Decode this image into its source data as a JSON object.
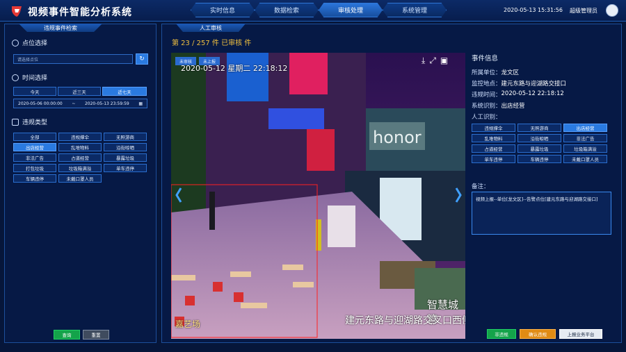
{
  "header": {
    "title": "视频事件智能分析系统",
    "nav": [
      "实时信息",
      "数据检索",
      "审核处理",
      "系统管理"
    ],
    "active_nav": 2,
    "datetime": "2020-05-13 15:31:56",
    "user": "超级管理员"
  },
  "left": {
    "panel_title": "违规事件检索",
    "location_title": "点位选择",
    "location_placeholder": "请选择点位",
    "time_title": "时间选择",
    "time_tabs": [
      "今天",
      "近三天",
      "近七天"
    ],
    "time_active": 2,
    "date_start": "2020-05-06 00:00:00",
    "date_sep": "~",
    "date_end": "2020-05-13 23:59:59",
    "violation_title": "违规类型",
    "violation_types": [
      "全部",
      "违规撑伞",
      "无照游商",
      "出店经营",
      "乱堆物料",
      "沿街晾晒",
      "非法广告",
      "占道经营",
      "暴露垃圾",
      "打包垃圾",
      "垃圾箱满溢",
      "单车违停",
      "车辆违停",
      "未戴口罩人员"
    ],
    "violation_active": 3,
    "query_label": "查询",
    "reset_label": "重置"
  },
  "middle": {
    "panel_title": "人工审核",
    "progress_text": "第 23 / 257 件 已审核 件",
    "tag_unreviewed": "未审核",
    "tag_unreported": "未上报",
    "overlay_date": "2020-05-12 星期二 22:18:12",
    "overlay_brand": "智慧城管",
    "overlay_location": "建元东路与迎湖路交叉口西侧",
    "overlay_corner": "嘉艺场"
  },
  "right": {
    "panel_title": "事件信息",
    "unit_label": "所属单位：",
    "unit_value": "龙文区",
    "site_label": "监控地点：",
    "site_value": "建元东路与迎湖路交接口",
    "time_label": "违规时间：",
    "time_value": "2020-05-12 22:18:12",
    "sys_label": "系统识别：",
    "sys_value": "出店经营",
    "manual_label": "人工识别：",
    "manual_types": [
      "违规撑伞",
      "无照游商",
      "出店经营",
      "乱堆物料",
      "沿街晾晒",
      "非法广告",
      "占道经营",
      "暴露垃圾",
      "垃圾箱满溢",
      "单车违停",
      "车辆违停",
      "未戴口罩人员"
    ],
    "manual_active": 2,
    "note_label": "备注：",
    "note_text": "视频上报--单位[龙文区]--告警点位[建元东路与迎湖路交接口]",
    "btn_not_violation": "非违规",
    "btn_confirm": "确认违规",
    "btn_report": "上报业务平台"
  },
  "colors": {
    "accent": "#2a7ae0",
    "panel_border": "#1d4f9c",
    "green": "#14a34a",
    "orange": "#e08b14"
  }
}
